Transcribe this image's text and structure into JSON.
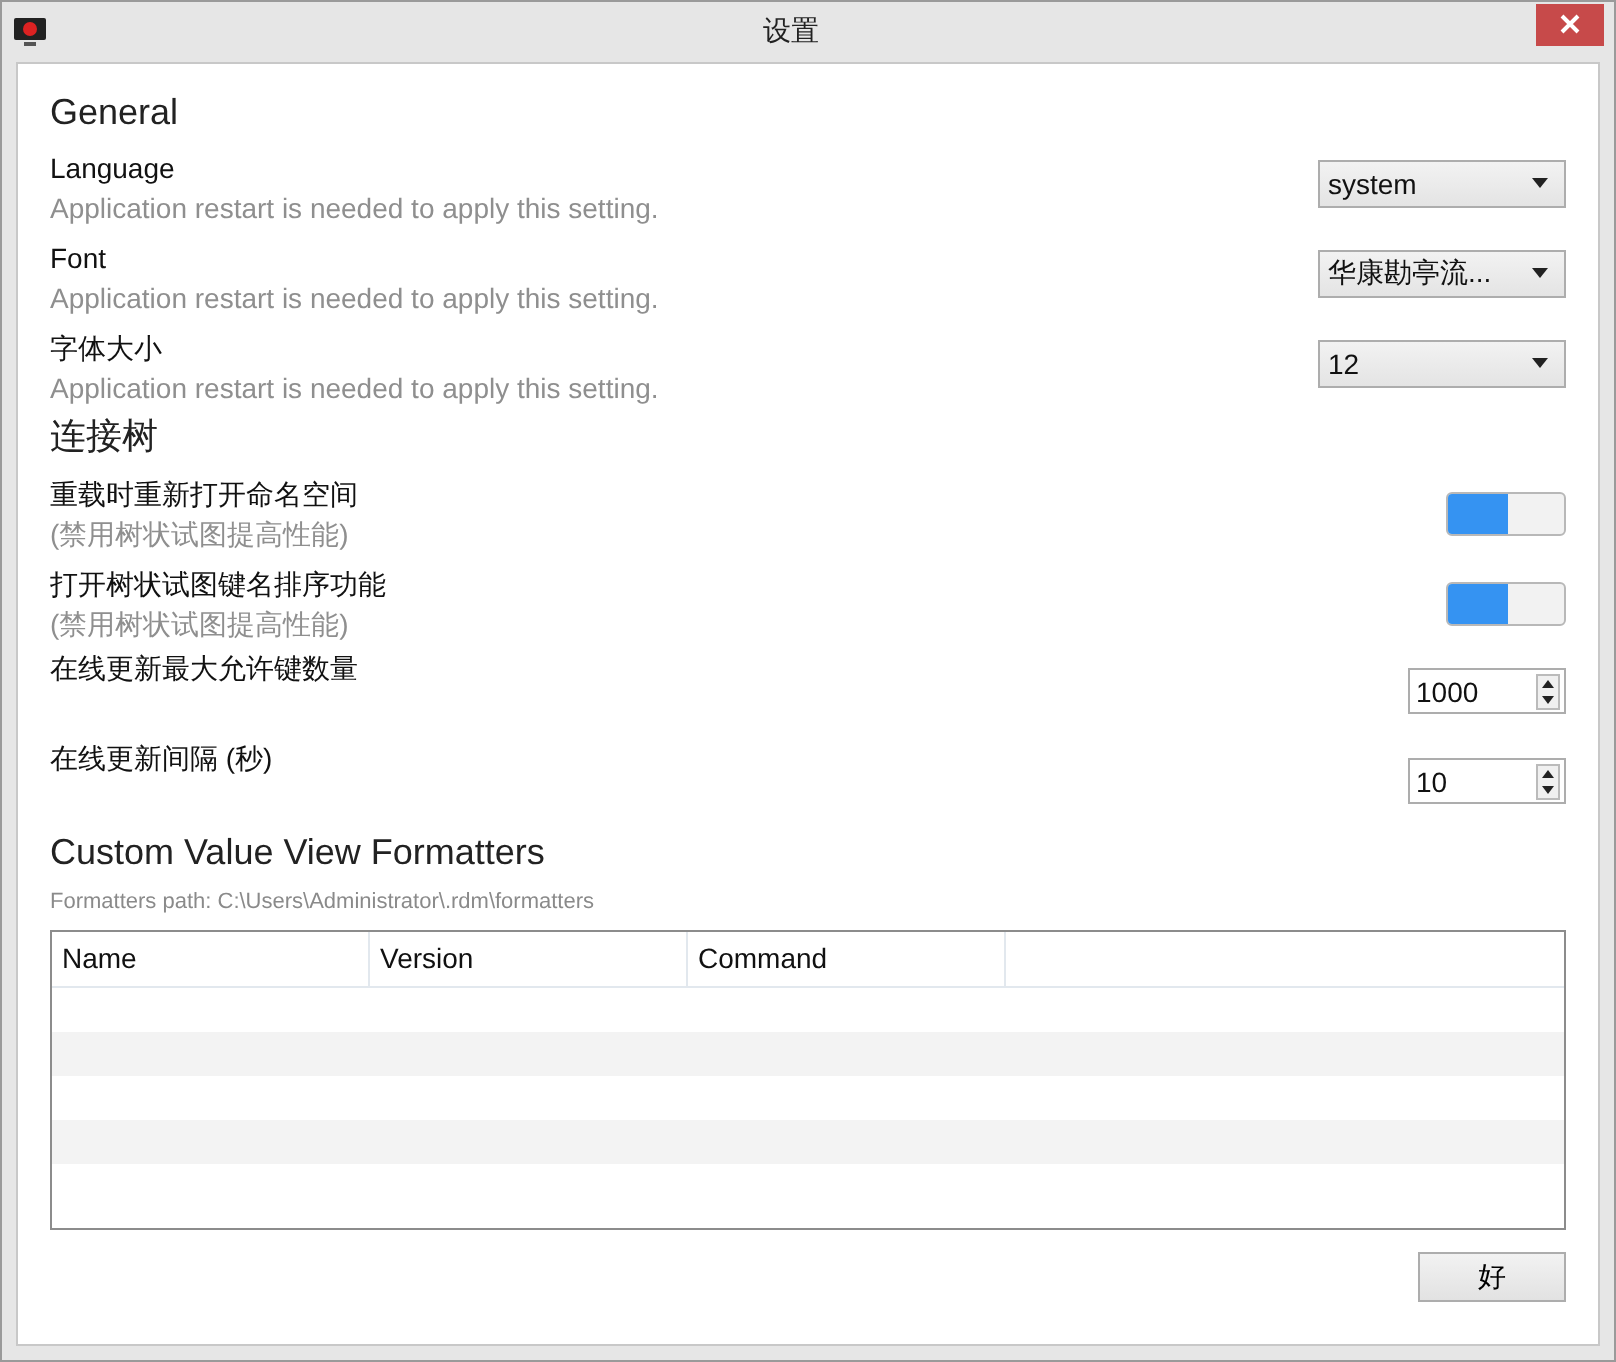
{
  "window": {
    "title": "设置"
  },
  "sections": [
    {
      "title": "General",
      "settings": [
        {
          "kind": "dropdown",
          "label": "Language",
          "hint": "Application restart is needed to apply this setting.",
          "value": "system"
        },
        {
          "kind": "dropdown",
          "label": "Font",
          "hint": "Application restart is needed to apply this setting.",
          "value": "华康勘亭流..."
        },
        {
          "kind": "dropdown",
          "label": "字体大小",
          "hint": "Application restart is needed to apply this setting.",
          "value": "12"
        }
      ]
    },
    {
      "title": "连接树",
      "settings": [
        {
          "kind": "toggle",
          "label": "重载时重新打开命名空间",
          "hint": "(禁用树状试图提高性能)",
          "on": true
        },
        {
          "kind": "toggle",
          "label": "打开树状试图键名排序功能",
          "hint": "(禁用树状试图提高性能)",
          "on": true
        },
        {
          "kind": "spinner",
          "label": "在线更新最大允许键数量",
          "value": "1000"
        },
        {
          "kind": "spinner",
          "label": "在线更新间隔 (秒)",
          "value": "10"
        }
      ]
    }
  ],
  "formatters": {
    "title": "Custom Value View Formatters",
    "path": "Formatters path: C:\\Users\\Administrator\\.rdm\\formatters",
    "table": {
      "columns": [
        "Name",
        "Version",
        "Command"
      ]
    }
  },
  "buttons": [
    "好"
  ]
}
